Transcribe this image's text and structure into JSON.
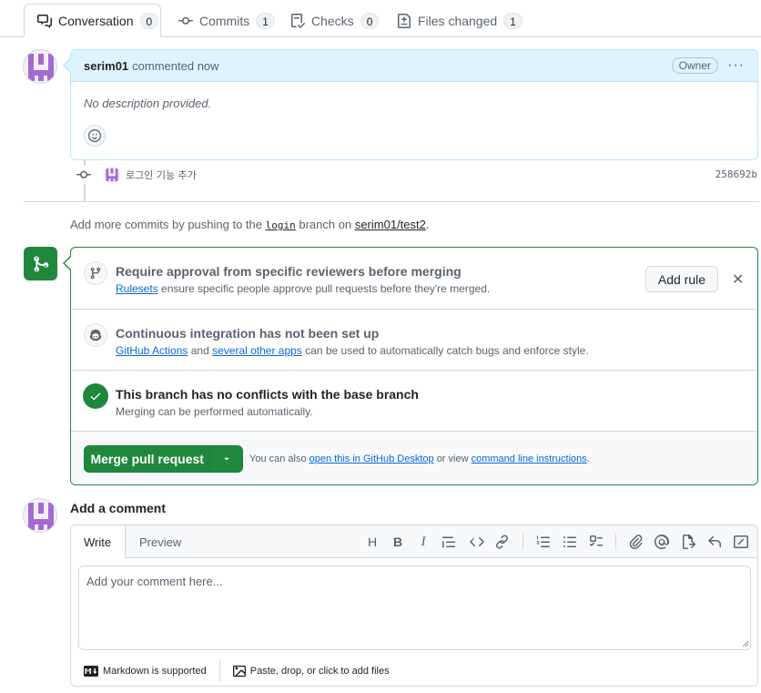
{
  "tabs": [
    {
      "label": "Conversation",
      "count": "0"
    },
    {
      "label": "Commits",
      "count": "1"
    },
    {
      "label": "Checks",
      "count": "0"
    },
    {
      "label": "Files changed",
      "count": "1"
    }
  ],
  "comment": {
    "author": "serim01",
    "action": "commented now",
    "badge": "Owner",
    "body": "No description provided."
  },
  "commit": {
    "message": "로그인 기능 추가",
    "sha": "258692b"
  },
  "push_hint": {
    "prefix": "Add more commits by pushing to the",
    "branch": "login",
    "middle": "branch on",
    "repo": "serim01/test2",
    "suffix": "."
  },
  "merge_box": {
    "rule_title": "Require approval from specific reviewers before merging",
    "rule_link": "Rulesets",
    "rule_sub": "ensure specific people approve pull requests before they're merged.",
    "add_rule_label": "Add rule",
    "ci_title": "Continuous integration has not been set up",
    "ci_link1": "GitHub Actions",
    "ci_and": "and",
    "ci_link2": "several other apps",
    "ci_sub": "can be used to automatically catch bugs and enforce style.",
    "conflict_title": "This branch has no conflicts with the base branch",
    "conflict_sub": "Merging can be performed automatically.",
    "merge_button_label": "Merge pull request",
    "hint_prefix": "You can also",
    "hint_link1": "open this in GitHub Desktop",
    "hint_middle": "or view",
    "hint_link2": "command line instructions",
    "hint_suffix": "."
  },
  "add_comment": {
    "title": "Add a comment",
    "write_tab": "Write",
    "preview_tab": "Preview",
    "placeholder": "Add your comment here...",
    "markdown_label": "Markdown is supported",
    "attach_label": "Paste, drop, or click to add files"
  },
  "colors": {
    "accent_green": "#1f883d",
    "link_blue": "#0969da",
    "header_blue": "#ddf4ff"
  }
}
